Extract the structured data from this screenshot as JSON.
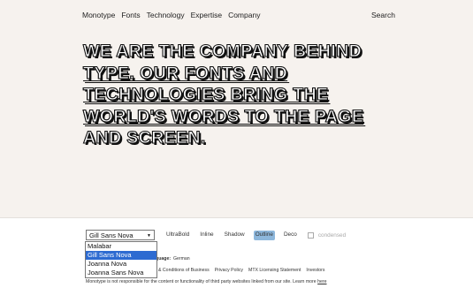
{
  "nav": {
    "items": [
      "Monotype",
      "Fonts",
      "Technology",
      "Expertise",
      "Company"
    ],
    "search": "Search"
  },
  "hero": {
    "lines": [
      "WE ARE THE COMPANY BEHIND",
      "TYPE. OUR FONTS AND",
      "TECHNOLOGIES BRING THE",
      "WORLD'S WORDS TO THE PAGE",
      "AND SCREEN."
    ]
  },
  "font_select": {
    "value": "Gill Sans Nova",
    "options": [
      "Malabar",
      "Gill Sans Nova",
      "Joanna Nova",
      "Joanna Sans Nova"
    ],
    "selected_index": 1
  },
  "styles": [
    "UltraBold",
    "Inline",
    "Shadow",
    "Outline",
    "Deco"
  ],
  "active_style": "Outline",
  "condensed_label": "condensed",
  "footer": {
    "language_label": "anguage:",
    "language_value": "German",
    "links": [
      "s & Conditions of Business",
      "Privacy Policy",
      "MTX Licensing Statement",
      "Investors"
    ],
    "note": "Monotype is not responsible for the content or functionality of third party websites linked from our site. Learn more",
    "note_link": "here"
  }
}
